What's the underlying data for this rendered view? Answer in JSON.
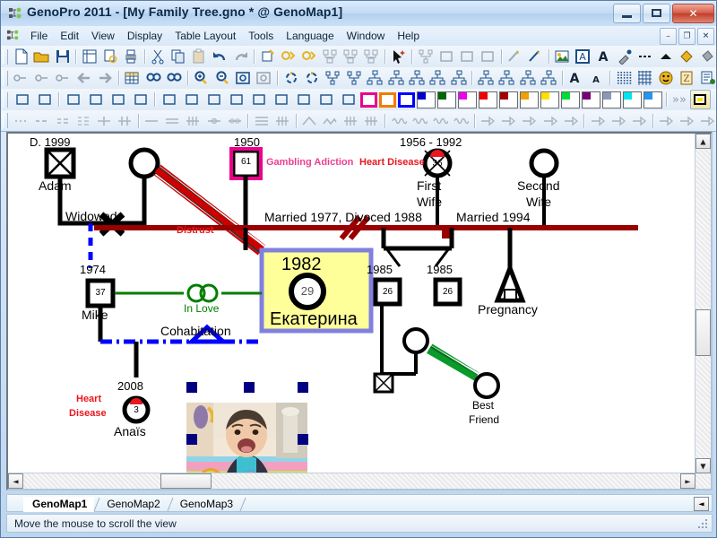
{
  "window": {
    "title": "GenoPro 2011 - [My Family Tree.gno * @ GenoMap1]",
    "app_icon": "genopro-tree-icon",
    "minimize_label": "Minimize",
    "maximize_label": "Maximize",
    "close_label": "Close"
  },
  "menu": {
    "icon": "genopro-tree-icon",
    "items": [
      {
        "label": "File",
        "accel": "F"
      },
      {
        "label": "Edit",
        "accel": "E"
      },
      {
        "label": "View",
        "accel": "V"
      },
      {
        "label": "Display",
        "accel": "D"
      },
      {
        "label": "Table Layout",
        "accel": "T"
      },
      {
        "label": "Tools",
        "accel": "T"
      },
      {
        "label": "Language",
        "accel": "L"
      },
      {
        "label": "Window",
        "accel": "W"
      },
      {
        "label": "Help",
        "accel": "H"
      }
    ],
    "mdi_buttons": [
      {
        "name": "mdi-minimize",
        "glyph": "–"
      },
      {
        "name": "mdi-restore",
        "glyph": "❐"
      },
      {
        "name": "mdi-close",
        "glyph": "✕"
      }
    ]
  },
  "toolbars": {
    "row1": [
      "new-document-icon",
      "open-folder-icon",
      "save-disk-icon",
      "sep",
      "page-layout-icon",
      "print-preview-icon",
      "print-icon",
      "sep",
      "cut-scissors-icon",
      "copy-icon",
      "paste-icon",
      "undo-arrow-icon",
      "redo-arrow-icon",
      "sep",
      "insert-individual-icon",
      "insert-family-icon",
      "insert-couple-icon",
      "insert-parents-icon",
      "insert-children-icon",
      "insert-sibling-icon",
      "sep",
      "select-tool-icon",
      "sep",
      "insert-pedigree-icon",
      "insert-twin-icon",
      "insert-descendant-icon",
      "insert-relation-icon",
      "sep",
      "emotional-link-icon",
      "social-link-icon",
      "sep",
      "insert-picture-icon",
      "text-box-icon",
      "font-color-icon",
      "eyedropper-icon",
      "dash-style-icon",
      "arrow-shape-icon",
      "diamond-shape-icon",
      "pour-paint-icon"
    ],
    "row2": [
      "gedcom-import-icon",
      "gedcom-export-icon",
      "gedcom-merge-icon",
      "back-arrow-icon",
      "forward-arrow-icon",
      "sep",
      "table-grid-icon",
      "find-binoculars-icon",
      "find-replace-icon",
      "sep",
      "zoom-in-icon",
      "zoom-out-icon",
      "zoom-selection-icon",
      "zoom-fit-icon",
      "sep",
      "refresh-layout-icon",
      "center-layout-icon",
      "tree-layout-icon",
      "tree-layout-alt-icon",
      "descendant-chart-icon",
      "ancestor-chart-icon",
      "hourglass-chart-icon",
      "family-chart-icon",
      "compact-chart-icon",
      "sep",
      "pedigree-chart-icon",
      "org-chart-icon",
      "pair-chart-icon",
      "cluster-chart-icon",
      "sep",
      "increase-font-icon",
      "decrease-font-icon",
      "sep",
      "dot-grid-icon",
      "line-grid-icon",
      "smiley-icon",
      "scroll-report-icon",
      "report-icon"
    ],
    "row3_shapes": [
      "curve-line-icon",
      "double-curve-icon",
      "sep",
      "single-slash-icon",
      "cross-slash-icon",
      "double-slash-icon",
      "quad-slash-icon",
      "sep",
      "fill-half-left-icon",
      "fill-half-bottom-icon",
      "fill-gradient-icon",
      "fill-corner-icon",
      "fill-two-left-icon",
      "fill-two-bottom-icon",
      "fill-quarters-icon",
      "fill-split-icon",
      "fill-top-split-icon"
    ],
    "row3_colors": [
      {
        "name": "swatch-magenta-outline",
        "hex": "#ec008c",
        "style": "outline"
      },
      {
        "name": "swatch-orange-outline",
        "hex": "#f07d00",
        "style": "outline"
      },
      {
        "name": "swatch-blue-outline",
        "hex": "#0000ff",
        "style": "outline"
      },
      {
        "name": "swatch-blue",
        "hex": "#0000cc",
        "style": "corner"
      },
      {
        "name": "swatch-green",
        "hex": "#006600",
        "style": "corner"
      },
      {
        "name": "swatch-magenta",
        "hex": "#ee00ee",
        "style": "corner"
      },
      {
        "name": "swatch-red",
        "hex": "#ee0000",
        "style": "corner"
      },
      {
        "name": "swatch-darkred",
        "hex": "#a10000",
        "style": "corner"
      },
      {
        "name": "swatch-amber",
        "hex": "#f0a000",
        "style": "corner"
      },
      {
        "name": "swatch-yellow",
        "hex": "#ffe000",
        "style": "corner"
      },
      {
        "name": "swatch-lime",
        "hex": "#00dd33",
        "style": "corner"
      },
      {
        "name": "swatch-purple",
        "hex": "#770077",
        "style": "corner"
      },
      {
        "name": "swatch-slate",
        "hex": "#8899bb",
        "style": "corner"
      },
      {
        "name": "swatch-cyan",
        "hex": "#00e5ee",
        "style": "corner"
      },
      {
        "name": "swatch-skyblue",
        "hex": "#2196f3",
        "style": "corner"
      }
    ],
    "row3_more": "more-colors-chevron-icon",
    "row3_last": "custom-color-icon",
    "row4": [
      "dotted-line-icon",
      "dashed-line-icon",
      "double-dash-icon",
      "triple-dash-icon",
      "line-tick-icon",
      "line-double-tick-icon",
      "sep",
      "solid-line-icon",
      "double-line-icon",
      "hatched-line-icon",
      "circle-line-icon",
      "double-circle-line-icon",
      "sep",
      "triple-line-icon",
      "hatched-heavy-icon",
      "sep",
      "peak-line-icon",
      "zigzag-line-icon",
      "cross-hatch-icon",
      "cross-hatch-heavy-icon",
      "sep",
      "wave-line-icon",
      "wave-heavy-icon",
      "wave-cross-icon",
      "wave-dense-icon",
      "sep",
      "arrow-open-icon",
      "arrow-filled-icon",
      "arrow-solid-icon",
      "arrow-dotted-icon",
      "arrow-dashed-icon",
      "sep",
      "cross-arrow-icon",
      "boxed-arrow-icon",
      "diamond-arrow-icon",
      "sep",
      "dot-arrow-icon",
      "double-dot-arrow-icon",
      "plain-arrow-icon"
    ]
  },
  "genogram": {
    "labels": {
      "adam_death": "D. 1999",
      "adam_name": "Adam",
      "widowed": "Widowed",
      "year_1950": "1950",
      "gambling": "Gambling Adiction",
      "heart_disease_top": "Heart Disease",
      "first_wife_years": "1956 - 1992",
      "first_wife_name_1": "First",
      "first_wife_name_2": "Wife",
      "second_wife_name_1": "Second",
      "second_wife_name_2": "Wife",
      "married_divorced": "Married 1977, Divoced 1988",
      "married_1994": "Married 1994",
      "distrust": "Distrust",
      "year_1974": "1974",
      "mike_name": "Mike",
      "in_love": "In Love",
      "cohabitation": "Cohabitation",
      "selected_year": "1982",
      "selected_name": "Екатерина",
      "twin_year_left": "1985",
      "twin_year_right": "1985",
      "pregnancy": "Pregnancy",
      "best_friend_1": "Best",
      "best_friend_2": "Friend",
      "year_2008": "2008",
      "heart_disease_1": "Heart",
      "heart_disease_2": "Disease",
      "anais_name": "Anaïs"
    },
    "ages": {
      "gambler": "61",
      "first_wife": "36",
      "mike": "37",
      "ekaterina": "29",
      "twin_left": "26",
      "twin_right": "26",
      "anais": "3"
    },
    "colors": {
      "selection_fill": "#ffff99",
      "selection_border": "#8080e0",
      "handle": "#000080",
      "marriage_line": "#990000",
      "gambling_box": "#ec008c",
      "love_line": "#007f00",
      "cohabitation_line": "#0000ff",
      "distrust_line": "#cc0000",
      "deceased_mark": "#000000"
    },
    "photo": {
      "name": "baby-photo",
      "alt": "Photo of a smiling baby on a colourful blanket"
    }
  },
  "tabs": {
    "items": [
      {
        "label": "GenoMap1",
        "active": true
      },
      {
        "label": "GenoMap2",
        "active": false
      },
      {
        "label": "GenoMap3",
        "active": false
      }
    ],
    "nav_glyph": "◄"
  },
  "scrollbars": {
    "up_glyph": "▲",
    "down_glyph": "▼",
    "left_glyph": "◄",
    "right_glyph": "►"
  },
  "status": {
    "message": "Move the mouse to scroll the view"
  }
}
